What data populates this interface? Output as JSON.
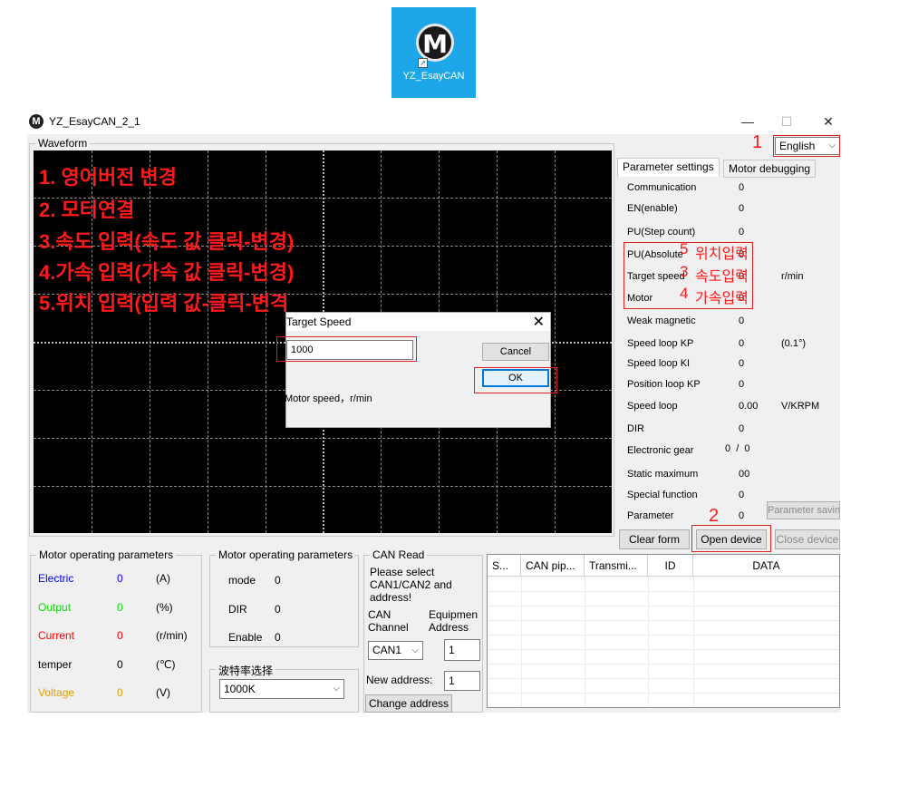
{
  "desktop_icon": {
    "label": "YZ_EsayCAN",
    "glyph": "M",
    "shortcut_glyph": "↗"
  },
  "window": {
    "title": "YZ_EsayCAN_2_1",
    "app_glyph": "M",
    "minimize": "—",
    "maximize": "☐",
    "close": "✕"
  },
  "waveform": {
    "title": "Waveform",
    "annotations": [
      "1. 영어버전 변경",
      "2. 모터연결",
      "3.속도 입력(속도 값 클릭-변경)",
      "4.가속 입력(가속 값 클릭-변경)",
      "5.위치 입력(입력 값-클릭-변격"
    ]
  },
  "dialog": {
    "title": "Target Speed",
    "close": "✕",
    "value": "1000",
    "cancel_label": "Cancel",
    "ok_label": "OK",
    "hint": "Motor speed，r/min"
  },
  "language": {
    "marker": "1",
    "selected": "English",
    "chevron": "⌵"
  },
  "tabs": {
    "param_settings": "Parameter settings",
    "motor_debugging": "Motor debugging"
  },
  "params": [
    {
      "label": "Communication",
      "value": "0",
      "unit": ""
    },
    {
      "label": "EN(enable)",
      "value": "0",
      "unit": ""
    },
    {
      "label": "PU(Step count)",
      "value": "0",
      "unit": ""
    },
    {
      "label": "PU(Absolute",
      "value": "0",
      "unit": ""
    },
    {
      "label": "Target speed",
      "value": "0",
      "unit": "r/min"
    },
    {
      "label": "Motor",
      "value": "0",
      "unit": ""
    },
    {
      "label": "Weak magnetic",
      "value": "0",
      "unit": ""
    },
    {
      "label": "Speed loop KP",
      "value": "0",
      "unit": "(0.1°)"
    },
    {
      "label": "Speed loop KI",
      "value": "0",
      "unit": ""
    },
    {
      "label": "Position loop KP",
      "value": "0",
      "unit": ""
    },
    {
      "label": "Speed loop",
      "value": "0.00",
      "unit": "V/KRPM"
    },
    {
      "label": "DIR",
      "value": "0",
      "unit": ""
    },
    {
      "label": "Electronic gear",
      "value": "0  /  0",
      "unit": ""
    },
    {
      "label": "Static maximum",
      "value": "00",
      "unit": ""
    },
    {
      "label": "Special function",
      "value": "0",
      "unit": ""
    },
    {
      "label": "Parameter",
      "value": "0",
      "unit": ""
    }
  ],
  "param_annotations": {
    "position_num": "5",
    "position_label": "위치입력",
    "speed_num": "3",
    "speed_label": "속도입력",
    "accel_num": "4",
    "accel_label": "가속입력"
  },
  "buttons": {
    "parameter_saving": "Parameter saving",
    "clear_form": "Clear form",
    "open_device": "Open device",
    "open_device_marker": "2",
    "close_device": "Close device"
  },
  "motor_params_1": {
    "title": "Motor operating parameters",
    "rows": [
      {
        "label": "Electric",
        "value": "0",
        "unit": "(A)",
        "color": "#0000ff"
      },
      {
        "label": "Output",
        "value": "0",
        "unit": "(%)",
        "color": "#00e000"
      },
      {
        "label": "Current",
        "value": "0",
        "unit": "(r/min)",
        "color": "#ff0000"
      },
      {
        "label": "temper",
        "value": "0",
        "unit": "(℃)",
        "color": "#000000"
      },
      {
        "label": "Voltage",
        "value": "0",
        "unit": "(V)",
        "color": "#e0a000"
      }
    ]
  },
  "motor_params_2": {
    "title": "Motor operating parameters",
    "rows": [
      {
        "label": "mode",
        "value": "0"
      },
      {
        "label": "DIR",
        "value": "0"
      },
      {
        "label": "Enable",
        "value": "0"
      }
    ]
  },
  "baud": {
    "title": "波特率选择",
    "selected": "1000K",
    "chevron": "⌵"
  },
  "can_read": {
    "title": "CAN Read",
    "instructions": [
      "Please select",
      "CAN1/CAN2 and",
      "address!"
    ],
    "channel_label": [
      "CAN",
      "Channel"
    ],
    "address_label": [
      "Equipmen",
      "Address"
    ],
    "channel": "CAN1",
    "chevron": "⌵",
    "address": "1",
    "new_address_label": "New address:",
    "new_address": "1",
    "change_address": "Change address"
  },
  "table": {
    "headers": [
      "S...",
      "CAN pip...",
      "Transmi...",
      "ID",
      "DATA"
    ]
  }
}
